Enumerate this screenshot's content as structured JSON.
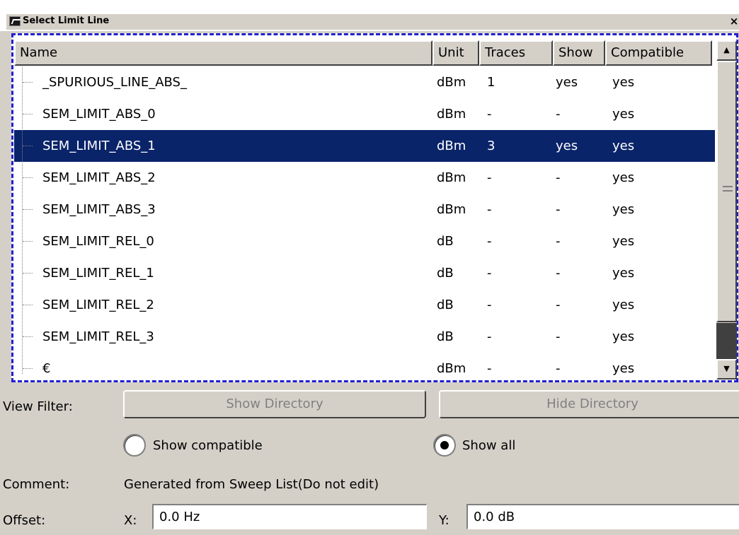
{
  "window": {
    "title": "Select Limit Line",
    "close_glyph": "×"
  },
  "table": {
    "columns": [
      {
        "key": "name",
        "label": "Name"
      },
      {
        "key": "unit",
        "label": "Unit"
      },
      {
        "key": "traces",
        "label": "Traces"
      },
      {
        "key": "show",
        "label": "Show"
      },
      {
        "key": "compatible",
        "label": "Compatible"
      }
    ],
    "rows": [
      {
        "name": "_SPURIOUS_LINE_ABS_",
        "unit": "dBm",
        "traces": "1",
        "show": "yes",
        "compatible": "yes",
        "selected": false
      },
      {
        "name": "SEM_LIMIT_ABS_0",
        "unit": "dBm",
        "traces": "-",
        "show": "-",
        "compatible": "yes",
        "selected": false
      },
      {
        "name": "SEM_LIMIT_ABS_1",
        "unit": "dBm",
        "traces": "3",
        "show": "yes",
        "compatible": "yes",
        "selected": true
      },
      {
        "name": "SEM_LIMIT_ABS_2",
        "unit": "dBm",
        "traces": "-",
        "show": "-",
        "compatible": "yes",
        "selected": false
      },
      {
        "name": "SEM_LIMIT_ABS_3",
        "unit": "dBm",
        "traces": "-",
        "show": "-",
        "compatible": "yes",
        "selected": false
      },
      {
        "name": "SEM_LIMIT_REL_0",
        "unit": "dB",
        "traces": "-",
        "show": "-",
        "compatible": "yes",
        "selected": false
      },
      {
        "name": "SEM_LIMIT_REL_1",
        "unit": "dB",
        "traces": "-",
        "show": "-",
        "compatible": "yes",
        "selected": false
      },
      {
        "name": "SEM_LIMIT_REL_2",
        "unit": "dB",
        "traces": "-",
        "show": "-",
        "compatible": "yes",
        "selected": false
      },
      {
        "name": "SEM_LIMIT_REL_3",
        "unit": "dB",
        "traces": "-",
        "show": "-",
        "compatible": "yes",
        "selected": false
      },
      {
        "name": "€",
        "unit": "dBm",
        "traces": "-",
        "show": "-",
        "compatible": "yes",
        "selected": false
      }
    ],
    "scrollbar": {
      "up_glyph": "▲",
      "down_glyph": "▼"
    }
  },
  "view_filter": {
    "label": "View Filter:",
    "show_directory_label": "Show Directory",
    "hide_directory_label": "Hide Directory",
    "radio_compatible_label": "Show compatible",
    "radio_all_label": "Show all",
    "selected": "all"
  },
  "comment": {
    "label": "Comment:",
    "value": "Generated from Sweep List(Do not edit)"
  },
  "offset": {
    "label": "Offset:",
    "x_label": "X:",
    "x_value": "0.0 Hz",
    "y_label": "Y:",
    "y_value": "0.0 dB"
  },
  "colors": {
    "selection": "#0a246a",
    "focus_rect": "#2020d0",
    "dialog_bg": "#d4d0c8"
  }
}
